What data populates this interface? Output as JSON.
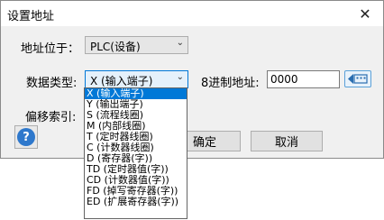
{
  "window": {
    "title": "设置地址",
    "close_glyph": "✕"
  },
  "form": {
    "location_label": "地址位于：",
    "location_value": "PLC(设备)",
    "datatype_label": "数据类型:",
    "datatype_value": "X (输入端子)",
    "address_label": "8进制地址:",
    "address_value": "0000",
    "offset_label": "偏移索引:"
  },
  "buttons": {
    "ok": "确定",
    "cancel": "取消",
    "help": "?"
  },
  "dropdown": {
    "items": [
      "X (输入端子)",
      "Y (输出端子)",
      "S (流程线圈)",
      "M (内部线圈)",
      "T (定时器线圈)",
      "C (计数器线圈)",
      "D (寄存器(字))",
      "TD (定时器值(字))",
      "CD (计数器值(字))",
      "FD (掉写寄存器(字))",
      "ED (扩展寄存器(字))"
    ],
    "selected_index": 0
  },
  "icons": {
    "chevron": "chevron-down-icon",
    "keypad": "keypad-icon",
    "help": "help-icon",
    "close": "close-icon"
  },
  "colors": {
    "accent": "#0078d7",
    "help_blue": "#2e78cc"
  }
}
